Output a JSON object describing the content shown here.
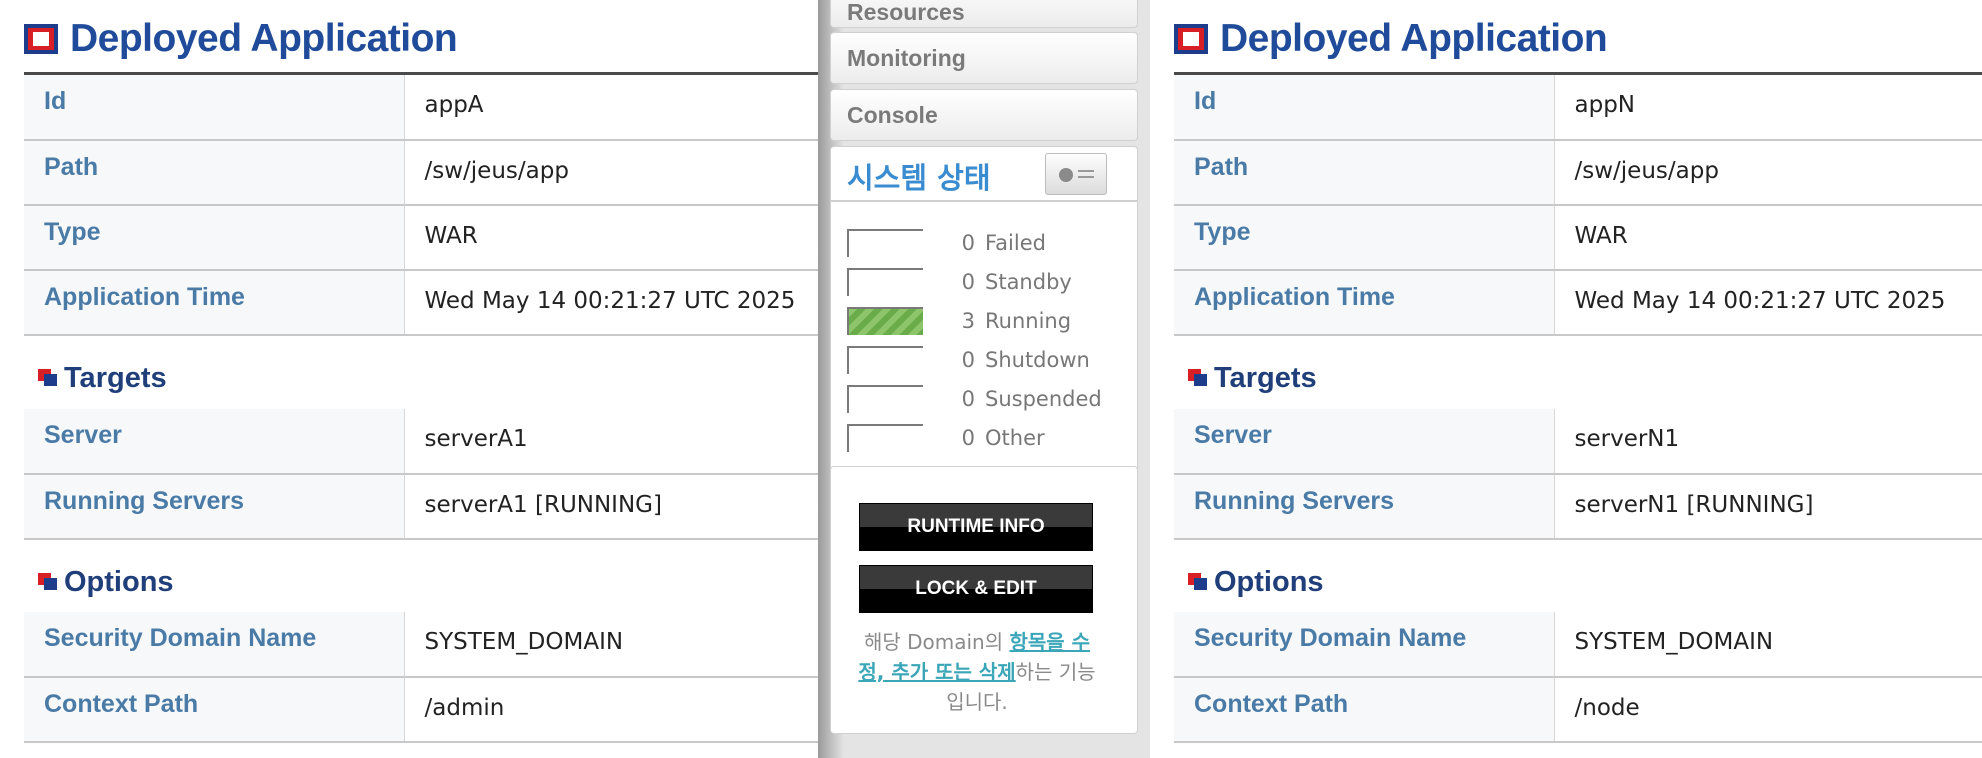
{
  "left": {
    "title": "Deployed Application",
    "rows": [
      {
        "key": "Id",
        "value": "appA"
      },
      {
        "key": "Path",
        "value": "/sw/jeus/app"
      },
      {
        "key": "Type",
        "value": "WAR"
      },
      {
        "key": "Application Time",
        "value": "Wed May 14 00:21:27 UTC 2025"
      }
    ],
    "targets_title": "Targets",
    "target_rows": [
      {
        "key": "Server",
        "value": "serverA1"
      },
      {
        "key": "Running Servers",
        "value": "serverA1 [RUNNING]"
      }
    ],
    "options_title": "Options",
    "option_rows": [
      {
        "key": "Security Domain Name",
        "value": "SYSTEM_DOMAIN"
      },
      {
        "key": "Context Path",
        "value": "/admin"
      }
    ]
  },
  "right": {
    "title": "Deployed Application",
    "rows": [
      {
        "key": "Id",
        "value": "appN"
      },
      {
        "key": "Path",
        "value": "/sw/jeus/app"
      },
      {
        "key": "Type",
        "value": "WAR"
      },
      {
        "key": "Application Time",
        "value": "Wed May 14 00:21:27 UTC 2025"
      }
    ],
    "targets_title": "Targets",
    "target_rows": [
      {
        "key": "Server",
        "value": "serverN1"
      },
      {
        "key": "Running Servers",
        "value": "serverN1 [RUNNING]"
      }
    ],
    "options_title": "Options",
    "option_rows": [
      {
        "key": "Security Domain Name",
        "value": "SYSTEM_DOMAIN"
      },
      {
        "key": "Context Path",
        "value": "/node"
      }
    ]
  },
  "sidebar": {
    "menu": [
      "Resources",
      "Monitoring",
      "Console"
    ],
    "status_title": "시스템 상태",
    "status_icon": "dashboard-icon",
    "status_rows": [
      {
        "count": "0",
        "label": "Failed",
        "fill": 0
      },
      {
        "count": "0",
        "label": "Standby",
        "fill": 0
      },
      {
        "count": "3",
        "label": "Running",
        "fill": 1
      },
      {
        "count": "0",
        "label": "Shutdown",
        "fill": 0
      },
      {
        "count": "0",
        "label": "Suspended",
        "fill": 0
      },
      {
        "count": "0",
        "label": "Other",
        "fill": 0
      }
    ],
    "runtime_info_label": "RUNTIME INFO",
    "lock_edit_label": "LOCK & EDIT",
    "desc_pre": "해당 Domain의 ",
    "desc_link": "항목을 수정, 추가 또는 삭제",
    "desc_post": "하는 기능입니다."
  },
  "colors": {
    "title_blue": "#1f4b9a",
    "key_blue": "#4a7ba7",
    "status_blue": "#3a8cd0",
    "running_green": "#7ab85a",
    "link_teal": "#3aa6b8"
  }
}
